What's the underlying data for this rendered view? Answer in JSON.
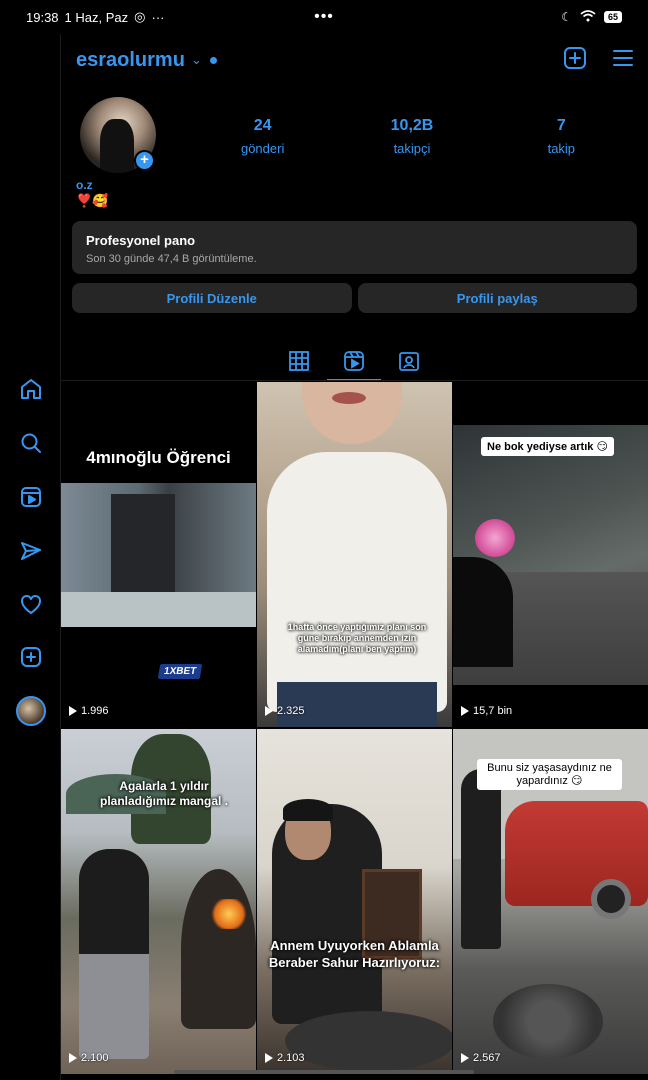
{
  "status": {
    "time": "19:38",
    "date": "1 Haz, Paz",
    "more": "···",
    "center_dots": "•••",
    "battery": "65"
  },
  "header": {
    "username": "esraolurmu",
    "chevron": "⌄"
  },
  "profile": {
    "stats": [
      {
        "value": "24",
        "label": "gönderi"
      },
      {
        "value": "10,2B",
        "label": "takipçi"
      },
      {
        "value": "7",
        "label": "takip"
      }
    ],
    "fullname": "o.z",
    "bio": "❣️🥰",
    "add_badge": "+"
  },
  "pro_panel": {
    "title": "Profesyonel pano",
    "subtitle": "Son 30 günde 47,4 B görüntüleme."
  },
  "buttons": {
    "edit": "Profili Düzenle",
    "share": "Profili paylaş"
  },
  "posts": [
    {
      "views": "1.996",
      "title": "4mınoğlu Öğrenci",
      "logo": "1XBET"
    },
    {
      "views": "2.325",
      "caption": "1hafta önce yaptığımız planı son güne bırakıp annemden izin alamadım(planı ben yaptım)"
    },
    {
      "views": "15,7 bin",
      "caption": "Ne bok yediyse artık 😏"
    },
    {
      "views": "2.100",
      "caption": "Agalarla 1 yıldır planladığımız mangal ."
    },
    {
      "views": "2.103",
      "caption": "Annem Uyuyorken Ablamla Beraber Sahur Hazırlıyoruz:"
    },
    {
      "views": "2.567",
      "caption": "Bunu siz yaşasaydınız ne yapardınız 😏"
    }
  ],
  "colors": {
    "accent": "#3797f0",
    "panel": "#262626",
    "background": "#000000"
  }
}
